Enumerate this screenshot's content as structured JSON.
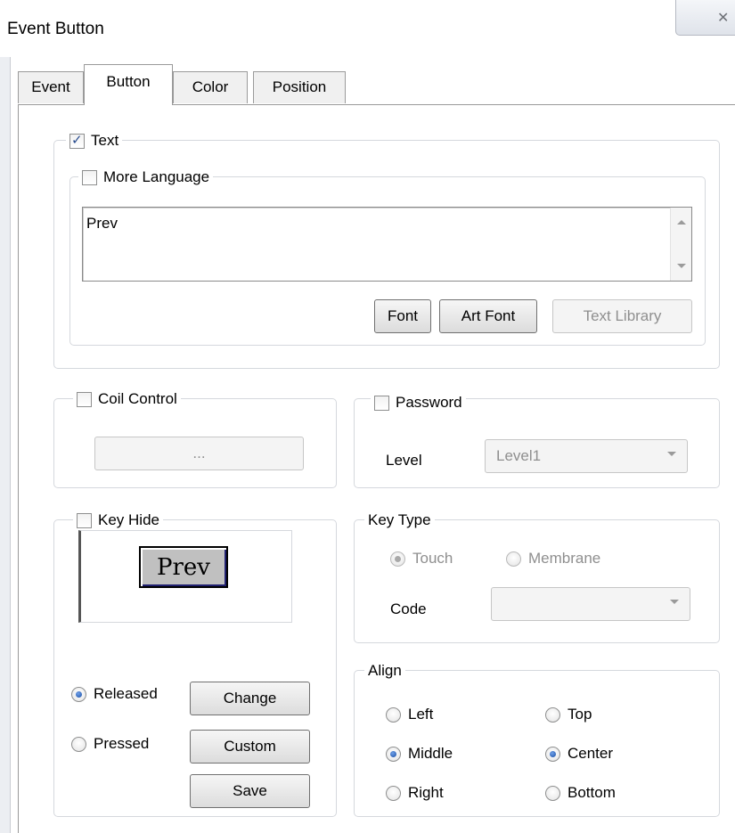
{
  "window": {
    "title": "Event Button",
    "close_glyph": "✕"
  },
  "tabs": [
    {
      "label": "Event",
      "active": false
    },
    {
      "label": "Button",
      "active": true
    },
    {
      "label": "Color",
      "active": false
    },
    {
      "label": "Position",
      "active": false
    }
  ],
  "text_group": {
    "label": "Text",
    "checked": true,
    "more_language": {
      "label": "More Language",
      "checked": false
    },
    "value": "Prev",
    "buttons": {
      "font": "Font",
      "art_font": "Art Font",
      "text_library": "Text Library"
    }
  },
  "coil_control": {
    "label": "Coil Control",
    "checked": false,
    "button_label": "..."
  },
  "password": {
    "label": "Password",
    "checked": false,
    "level_label": "Level",
    "level_value": "Level1"
  },
  "key_hide": {
    "label": "Key Hide",
    "checked": false,
    "preview_text": "Prev"
  },
  "key_type": {
    "label": "Key Type",
    "options": [
      {
        "label": "Touch",
        "selected": true
      },
      {
        "label": "Membrane",
        "selected": false
      }
    ],
    "code_label": "Code",
    "code_value": ""
  },
  "state": {
    "options": [
      {
        "label": "Released",
        "selected": true
      },
      {
        "label": "Pressed",
        "selected": false
      }
    ],
    "buttons": {
      "change": "Change",
      "custom": "Custom",
      "save": "Save"
    }
  },
  "align": {
    "label": "Align",
    "horizontal": [
      {
        "label": "Left",
        "selected": false
      },
      {
        "label": "Middle",
        "selected": true
      },
      {
        "label": "Right",
        "selected": false
      }
    ],
    "vertical": [
      {
        "label": "Top",
        "selected": false
      },
      {
        "label": "Center",
        "selected": true
      },
      {
        "label": "Bottom",
        "selected": false
      }
    ]
  },
  "colors": {
    "accent": "#1a4fa6",
    "border": "#9a9a9a",
    "disabled_text": "#8f8f8f"
  }
}
